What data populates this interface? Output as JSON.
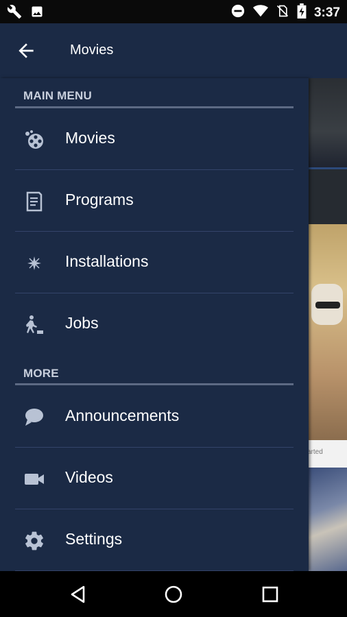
{
  "status_bar": {
    "time": "3:37",
    "left_icons": [
      "wrench-icon",
      "image-icon"
    ],
    "right_icons": [
      "do-not-disturb-icon",
      "wifi-icon",
      "no-sim-icon",
      "battery-charging-icon"
    ]
  },
  "app_bar": {
    "title": "Movies",
    "back_icon": "arrow-back-icon"
  },
  "drawer": {
    "sections": [
      {
        "header": "MAIN MENU",
        "items": [
          {
            "label": "Movies",
            "icon": "film-reel-icon"
          },
          {
            "label": "Programs",
            "icon": "document-icon"
          },
          {
            "label": "Installations",
            "icon": "sparkle-icon"
          },
          {
            "label": "Jobs",
            "icon": "worker-icon"
          }
        ]
      },
      {
        "header": "MORE",
        "items": [
          {
            "label": "Announcements",
            "icon": "chat-bubble-icon"
          },
          {
            "label": "Videos",
            "icon": "video-camera-icon"
          },
          {
            "label": "Settings",
            "icon": "gear-icon"
          }
        ]
      }
    ]
  },
  "background_content": {
    "partial_text": "arted"
  },
  "colors": {
    "primary": "#1b2a45",
    "divider": "#34446a",
    "section_line": "#5d6a84",
    "icon": "#b8c2d4"
  },
  "nav_bar": {
    "buttons": [
      "back-triangle-icon",
      "home-circle-icon",
      "recents-square-icon"
    ]
  }
}
